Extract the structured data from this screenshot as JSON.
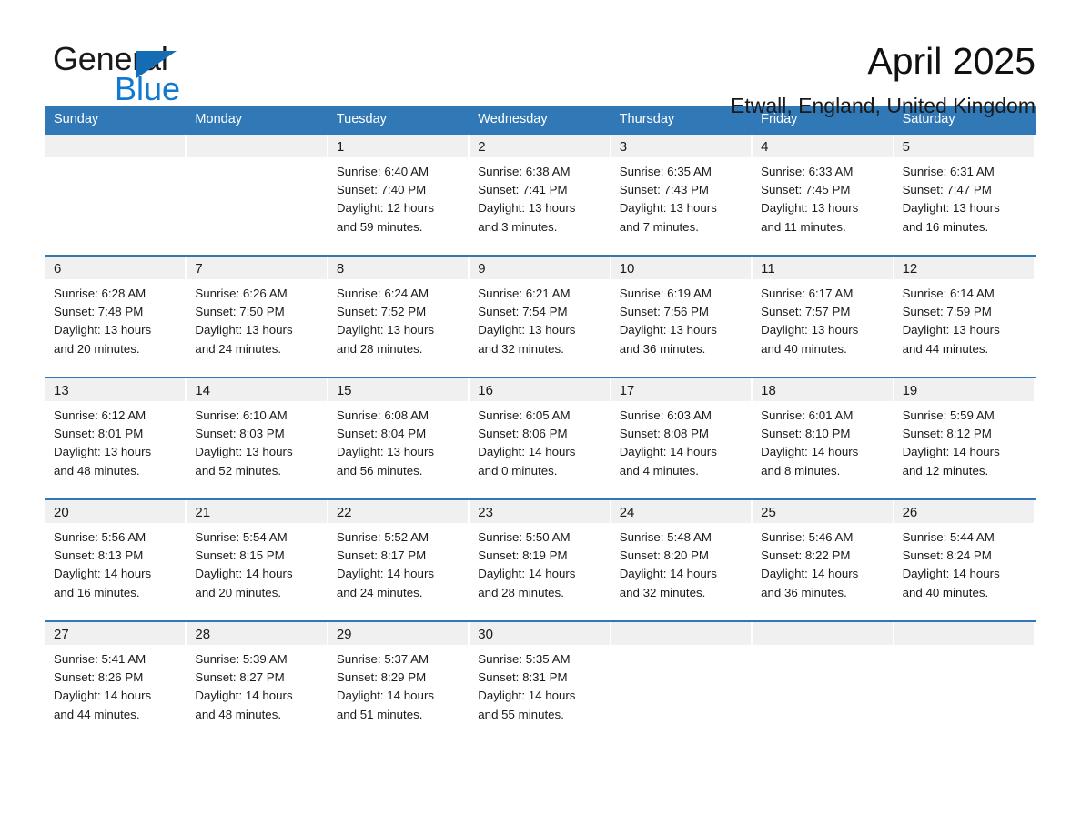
{
  "brand": {
    "name_top": "General",
    "name_bottom": "Blue"
  },
  "header": {
    "month_title": "April 2025",
    "location": "Etwall, England, United Kingdom"
  },
  "colors": {
    "header_blue": "#3178b6",
    "logo_blue": "#1179d0",
    "date_band": "#f0f0f0",
    "text": "#1a1a1a"
  },
  "weekdays": [
    "Sunday",
    "Monday",
    "Tuesday",
    "Wednesday",
    "Thursday",
    "Friday",
    "Saturday"
  ],
  "weeks": [
    [
      {
        "day": "",
        "info": ""
      },
      {
        "day": "",
        "info": ""
      },
      {
        "day": "1",
        "info": "Sunrise: 6:40 AM\nSunset: 7:40 PM\nDaylight: 12 hours\nand 59 minutes."
      },
      {
        "day": "2",
        "info": "Sunrise: 6:38 AM\nSunset: 7:41 PM\nDaylight: 13 hours\nand 3 minutes."
      },
      {
        "day": "3",
        "info": "Sunrise: 6:35 AM\nSunset: 7:43 PM\nDaylight: 13 hours\nand 7 minutes."
      },
      {
        "day": "4",
        "info": "Sunrise: 6:33 AM\nSunset: 7:45 PM\nDaylight: 13 hours\nand 11 minutes."
      },
      {
        "day": "5",
        "info": "Sunrise: 6:31 AM\nSunset: 7:47 PM\nDaylight: 13 hours\nand 16 minutes."
      }
    ],
    [
      {
        "day": "6",
        "info": "Sunrise: 6:28 AM\nSunset: 7:48 PM\nDaylight: 13 hours\nand 20 minutes."
      },
      {
        "day": "7",
        "info": "Sunrise: 6:26 AM\nSunset: 7:50 PM\nDaylight: 13 hours\nand 24 minutes."
      },
      {
        "day": "8",
        "info": "Sunrise: 6:24 AM\nSunset: 7:52 PM\nDaylight: 13 hours\nand 28 minutes."
      },
      {
        "day": "9",
        "info": "Sunrise: 6:21 AM\nSunset: 7:54 PM\nDaylight: 13 hours\nand 32 minutes."
      },
      {
        "day": "10",
        "info": "Sunrise: 6:19 AM\nSunset: 7:56 PM\nDaylight: 13 hours\nand 36 minutes."
      },
      {
        "day": "11",
        "info": "Sunrise: 6:17 AM\nSunset: 7:57 PM\nDaylight: 13 hours\nand 40 minutes."
      },
      {
        "day": "12",
        "info": "Sunrise: 6:14 AM\nSunset: 7:59 PM\nDaylight: 13 hours\nand 44 minutes."
      }
    ],
    [
      {
        "day": "13",
        "info": "Sunrise: 6:12 AM\nSunset: 8:01 PM\nDaylight: 13 hours\nand 48 minutes."
      },
      {
        "day": "14",
        "info": "Sunrise: 6:10 AM\nSunset: 8:03 PM\nDaylight: 13 hours\nand 52 minutes."
      },
      {
        "day": "15",
        "info": "Sunrise: 6:08 AM\nSunset: 8:04 PM\nDaylight: 13 hours\nand 56 minutes."
      },
      {
        "day": "16",
        "info": "Sunrise: 6:05 AM\nSunset: 8:06 PM\nDaylight: 14 hours\nand 0 minutes."
      },
      {
        "day": "17",
        "info": "Sunrise: 6:03 AM\nSunset: 8:08 PM\nDaylight: 14 hours\nand 4 minutes."
      },
      {
        "day": "18",
        "info": "Sunrise: 6:01 AM\nSunset: 8:10 PM\nDaylight: 14 hours\nand 8 minutes."
      },
      {
        "day": "19",
        "info": "Sunrise: 5:59 AM\nSunset: 8:12 PM\nDaylight: 14 hours\nand 12 minutes."
      }
    ],
    [
      {
        "day": "20",
        "info": "Sunrise: 5:56 AM\nSunset: 8:13 PM\nDaylight: 14 hours\nand 16 minutes."
      },
      {
        "day": "21",
        "info": "Sunrise: 5:54 AM\nSunset: 8:15 PM\nDaylight: 14 hours\nand 20 minutes."
      },
      {
        "day": "22",
        "info": "Sunrise: 5:52 AM\nSunset: 8:17 PM\nDaylight: 14 hours\nand 24 minutes."
      },
      {
        "day": "23",
        "info": "Sunrise: 5:50 AM\nSunset: 8:19 PM\nDaylight: 14 hours\nand 28 minutes."
      },
      {
        "day": "24",
        "info": "Sunrise: 5:48 AM\nSunset: 8:20 PM\nDaylight: 14 hours\nand 32 minutes."
      },
      {
        "day": "25",
        "info": "Sunrise: 5:46 AM\nSunset: 8:22 PM\nDaylight: 14 hours\nand 36 minutes."
      },
      {
        "day": "26",
        "info": "Sunrise: 5:44 AM\nSunset: 8:24 PM\nDaylight: 14 hours\nand 40 minutes."
      }
    ],
    [
      {
        "day": "27",
        "info": "Sunrise: 5:41 AM\nSunset: 8:26 PM\nDaylight: 14 hours\nand 44 minutes."
      },
      {
        "day": "28",
        "info": "Sunrise: 5:39 AM\nSunset: 8:27 PM\nDaylight: 14 hours\nand 48 minutes."
      },
      {
        "day": "29",
        "info": "Sunrise: 5:37 AM\nSunset: 8:29 PM\nDaylight: 14 hours\nand 51 minutes."
      },
      {
        "day": "30",
        "info": "Sunrise: 5:35 AM\nSunset: 8:31 PM\nDaylight: 14 hours\nand 55 minutes."
      },
      {
        "day": "",
        "info": ""
      },
      {
        "day": "",
        "info": ""
      },
      {
        "day": "",
        "info": ""
      }
    ]
  ]
}
